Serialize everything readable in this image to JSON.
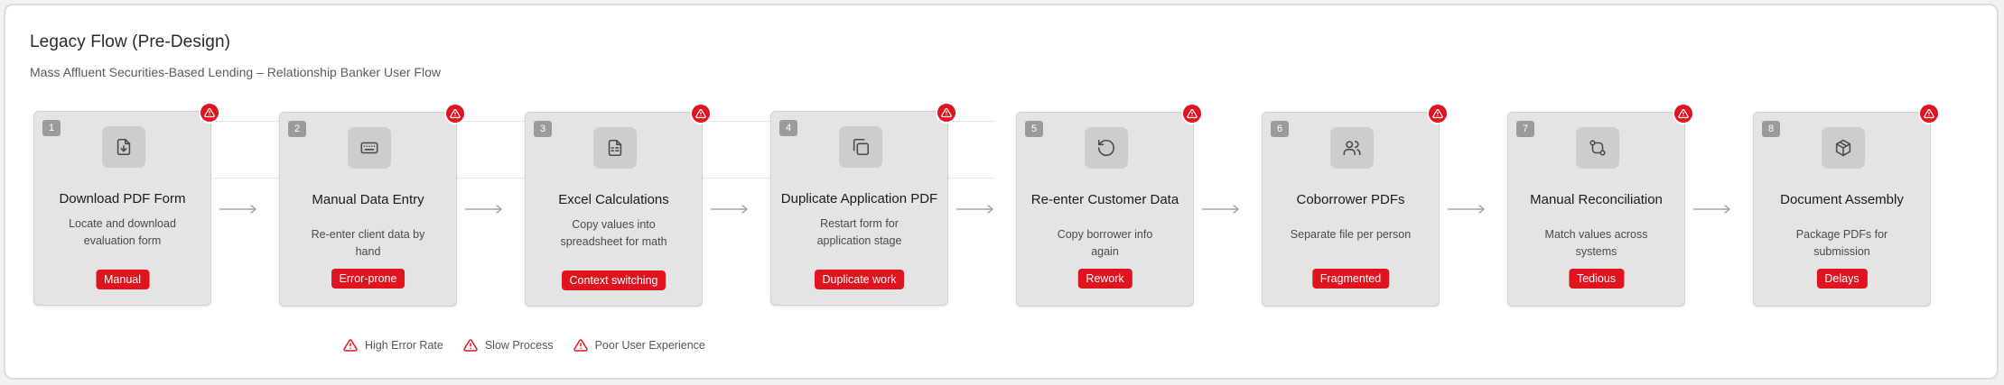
{
  "header": {
    "title": "Legacy Flow (Pre-Design)",
    "subtitle": "Mass Affluent Securities-Based Lending – Relationship Banker User Flow"
  },
  "colors": {
    "alert": "#e0141e",
    "card": "#e4e4e4",
    "icon_tile": "#cdcdcd",
    "number_tag": "#9b9b9b"
  },
  "steps": [
    {
      "number": "1",
      "title": "Download PDF Form",
      "desc": [
        "Locate and download",
        "evaluation form"
      ],
      "badge": "Manual",
      "icon": "file-download-icon",
      "alert_icon": "warning-triangle-icon"
    },
    {
      "number": "2",
      "title": "Manual Data Entry",
      "desc": [
        "Re-enter client data by hand"
      ],
      "badge": "Error-prone",
      "icon": "keyboard-icon",
      "alert_icon": "warning-triangle-icon"
    },
    {
      "number": "3",
      "title": "Excel Calculations",
      "desc": [
        "Copy values into",
        "spreadsheet for math"
      ],
      "badge": "Context switching",
      "icon": "spreadsheet-icon",
      "alert_icon": "warning-triangle-icon"
    },
    {
      "number": "4",
      "title": "Duplicate Application PDF",
      "desc": [
        "Restart form for",
        "application stage"
      ],
      "badge": "Duplicate work",
      "icon": "copy-icon",
      "alert_icon": "warning-triangle-icon"
    },
    {
      "number": "5",
      "title": "Re-enter Customer Data",
      "desc": [
        "Copy borrower info again"
      ],
      "badge": "Rework",
      "icon": "rotate-icon",
      "alert_icon": "warning-triangle-icon"
    },
    {
      "number": "6",
      "title": "Coborrower PDFs",
      "desc": [
        "Separate file per person"
      ],
      "badge": "Fragmented",
      "icon": "users-icon",
      "alert_icon": "warning-triangle-icon"
    },
    {
      "number": "7",
      "title": "Manual Reconciliation",
      "desc": [
        "Match values across systems"
      ],
      "badge": "Tedious",
      "icon": "git-compare-icon",
      "alert_icon": "warning-triangle-icon"
    },
    {
      "number": "8",
      "title": "Document Assembly",
      "desc": [
        "Package PDFs for submission"
      ],
      "badge": "Delays",
      "icon": "package-icon",
      "alert_icon": "warning-triangle-icon"
    }
  ],
  "legend": [
    {
      "label": "High Error Rate",
      "icon": "warning-triangle-icon"
    },
    {
      "label": "Slow Process",
      "icon": "warning-triangle-icon"
    },
    {
      "label": "Poor User Experience",
      "icon": "warning-triangle-icon"
    }
  ]
}
